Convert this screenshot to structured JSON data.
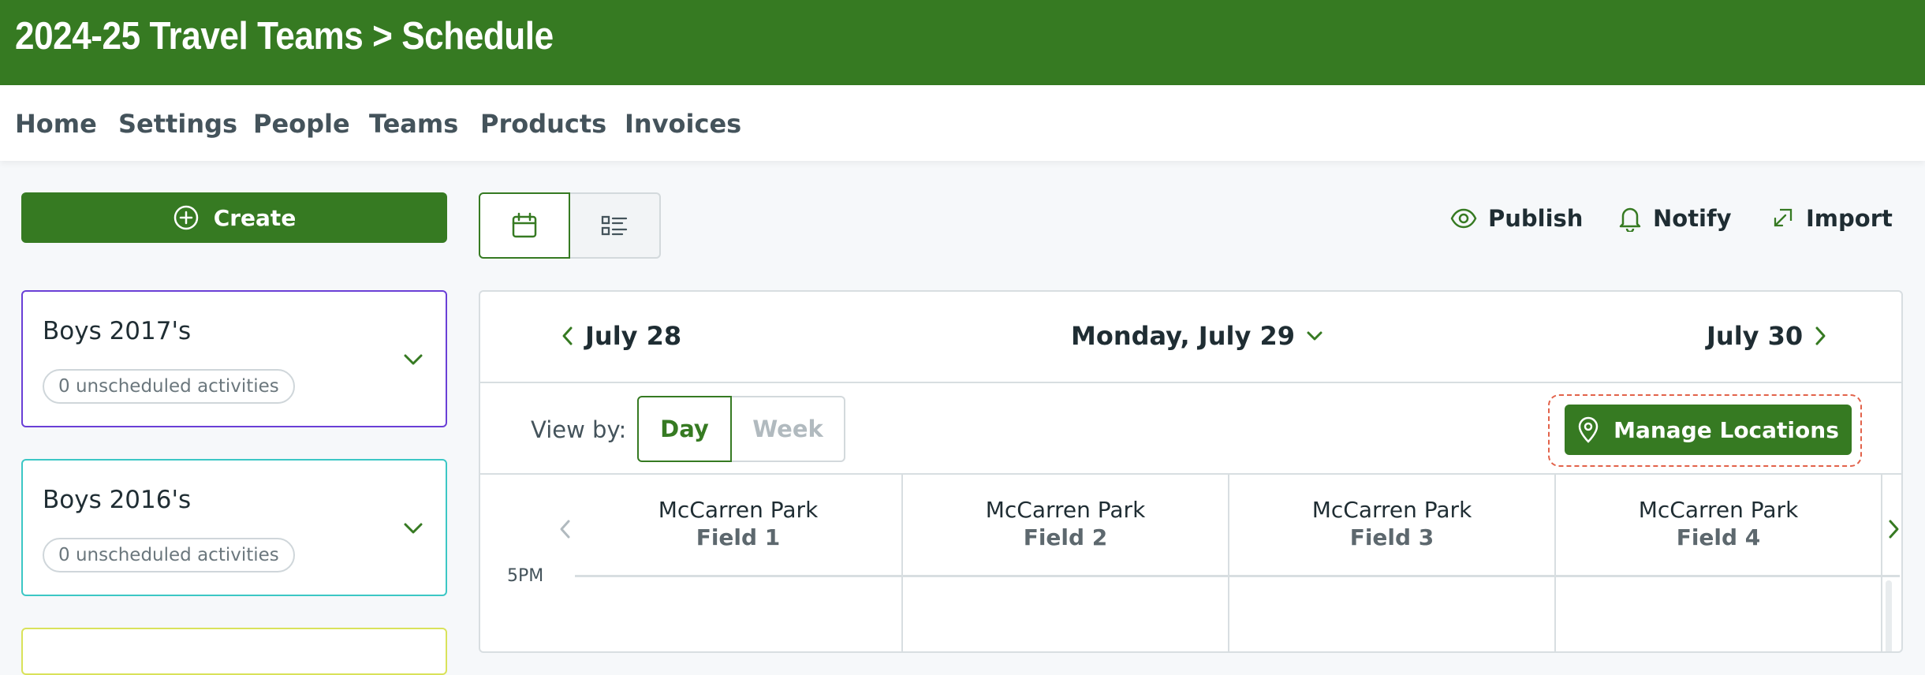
{
  "header": {
    "title": "2024-25 Travel Teams > Schedule"
  },
  "nav": {
    "items": [
      "Home",
      "Settings",
      "People",
      "Teams",
      "Products",
      "Invoices"
    ]
  },
  "sidebar": {
    "create_label": "Create",
    "teams": [
      {
        "name": "Boys 2017's",
        "status": "0 unscheduled activities",
        "color": "#6a3fd6"
      },
      {
        "name": "Boys 2016's",
        "status": "0 unscheduled activities",
        "color": "#3cc7c5"
      }
    ]
  },
  "toolbar": {
    "publish": "Publish",
    "notify": "Notify",
    "import": "Import"
  },
  "datebar": {
    "prev": "July 28",
    "current": "Monday, July 29",
    "next": "July 30"
  },
  "viewbar": {
    "label": "View by:",
    "day": "Day",
    "week": "Week",
    "manage": "Manage Locations"
  },
  "columns": [
    {
      "park": "McCarren Park",
      "field": "Field 1"
    },
    {
      "park": "McCarren Park",
      "field": "Field 2"
    },
    {
      "park": "McCarren Park",
      "field": "Field 3"
    },
    {
      "park": "McCarren Park",
      "field": "Field 4"
    }
  ],
  "time": {
    "first": "5PM"
  },
  "colors": {
    "brand": "#367a22",
    "highlight": "#e2624a"
  }
}
